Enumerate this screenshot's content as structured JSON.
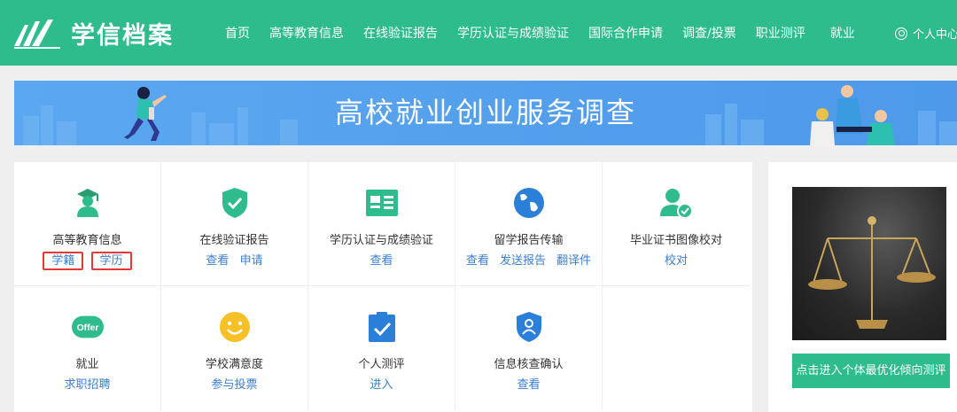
{
  "header": {
    "logo_text": "学信档案",
    "nav": [
      "首页",
      "高等教育信息",
      "在线验证报告",
      "学历认证与成绩验证",
      "国际合作申请",
      "调查/投票",
      "职业测评",
      "就业"
    ],
    "user_label": "个人中心"
  },
  "banner": {
    "title": "高校就业创业服务调查"
  },
  "services": [
    {
      "title": "高等教育信息",
      "icon": "graduate-icon",
      "links": [
        "学籍",
        "学历"
      ]
    },
    {
      "title": "在线验证报告",
      "icon": "shield-check-icon",
      "links": [
        "查看",
        "申请"
      ]
    },
    {
      "title": "学历认证与成绩验证",
      "icon": "id-card-icon",
      "links": [
        "查看"
      ]
    },
    {
      "title": "留学报告传输",
      "icon": "globe-icon",
      "links": [
        "查看",
        "发送报告",
        "翻译件"
      ]
    },
    {
      "title": "毕业证书图像校对",
      "icon": "user-check-icon",
      "links": [
        "校对"
      ]
    },
    {
      "title": "就业",
      "icon": "offer-icon",
      "offer_text": "Offer",
      "links": [
        "求职招聘"
      ]
    },
    {
      "title": "学校满意度",
      "icon": "smiley-icon",
      "links": [
        "参与投票"
      ]
    },
    {
      "title": "个人测评",
      "icon": "clipboard-check-icon",
      "links": [
        "进入"
      ]
    },
    {
      "title": "信息核查确认",
      "icon": "shield-user-icon",
      "links": [
        "查看"
      ]
    }
  ],
  "promo": {
    "button": "点击进入个体最优化倾向测评",
    "image": "scales-of-justice-image"
  },
  "colors": {
    "brand_green": "#2fbc8c",
    "banner_blue": "#4e99ea",
    "link_blue": "#3a7fd5",
    "highlight_red": "#e53935"
  }
}
